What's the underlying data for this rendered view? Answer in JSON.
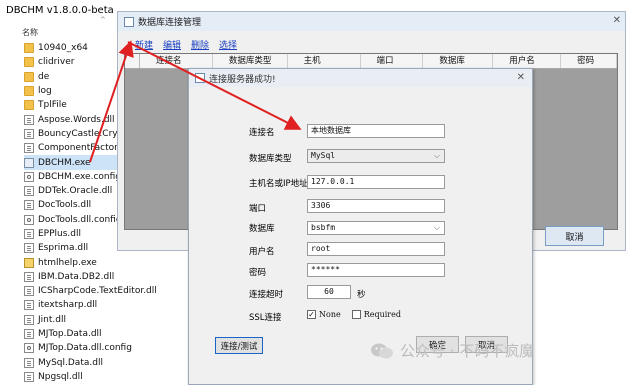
{
  "explorer": {
    "title": "DBCHM v1.8.0.0-beta",
    "column_name": "名称",
    "files": [
      {
        "name": "10940_x64",
        "icon": "folder"
      },
      {
        "name": "clidriver",
        "icon": "folder"
      },
      {
        "name": "de",
        "icon": "folder"
      },
      {
        "name": "log",
        "icon": "folder"
      },
      {
        "name": "TplFile",
        "icon": "folder"
      },
      {
        "name": "Aspose.Words.dll",
        "icon": "dll"
      },
      {
        "name": "BouncyCastle.Crypto",
        "icon": "dll"
      },
      {
        "name": "ComponentFactory.K",
        "icon": "dll"
      },
      {
        "name": "DBCHM.exe",
        "icon": "exe",
        "selected": true
      },
      {
        "name": "DBCHM.exe.config",
        "icon": "config"
      },
      {
        "name": "DDTek.Oracle.dll",
        "icon": "dll"
      },
      {
        "name": "DocTools.dll",
        "icon": "dll"
      },
      {
        "name": "DocTools.dll.config",
        "icon": "config"
      },
      {
        "name": "EPPlus.dll",
        "icon": "dll"
      },
      {
        "name": "Esprima.dll",
        "icon": "dll"
      },
      {
        "name": "htmlhelp.exe",
        "icon": "chm"
      },
      {
        "name": "IBM.Data.DB2.dll",
        "icon": "dll"
      },
      {
        "name": "ICSharpCode.TextEditor.dll",
        "icon": "dll"
      },
      {
        "name": "itextsharp.dll",
        "icon": "dll"
      },
      {
        "name": "Jint.dll",
        "icon": "dll"
      },
      {
        "name": "MJTop.Data.dll",
        "icon": "dll"
      },
      {
        "name": "MJTop.Data.dll.config",
        "icon": "config"
      },
      {
        "name": "MySql.Data.dll",
        "icon": "dll"
      },
      {
        "name": "Npgsql.dll",
        "icon": "dll"
      }
    ]
  },
  "main_dialog": {
    "title": "数据库连接管理",
    "toolbar": {
      "new": "新建",
      "edit": "编辑",
      "delete": "删除",
      "select": "选择"
    },
    "columns": [
      "连接名",
      "数据库类型",
      "主机",
      "端口",
      "数据库",
      "用户名",
      "密码"
    ],
    "cancel_label": "取消"
  },
  "conn_dialog": {
    "title": "连接服务器成功!",
    "fields": {
      "conn_name": {
        "label": "连接名",
        "value": "本地数据库"
      },
      "db_type": {
        "label": "数据库类型",
        "value": "MySql"
      },
      "host": {
        "label": "主机名或IP地址",
        "value": "127.0.0.1"
      },
      "port": {
        "label": "端口",
        "value": "3306"
      },
      "database": {
        "label": "数据库",
        "value": "bsbfm"
      },
      "username": {
        "label": "用户名",
        "value": "root"
      },
      "password": {
        "label": "密码",
        "value": "******"
      },
      "timeout": {
        "label": "连接超时",
        "value": "60",
        "unit": "秒"
      },
      "ssl": {
        "label": "SSL连接",
        "none_label": "None",
        "required_label": "Required",
        "none_checked": true,
        "required_checked": false
      }
    },
    "buttons": {
      "test": "连接/测试",
      "ok": "确定",
      "cancel": "取消"
    }
  },
  "watermark": {
    "text": "公众号 · 不码不疯魔"
  },
  "colors": {
    "arrow": "#e02020",
    "link": "#1a3fbf",
    "selected_row": "#cde3f7"
  }
}
